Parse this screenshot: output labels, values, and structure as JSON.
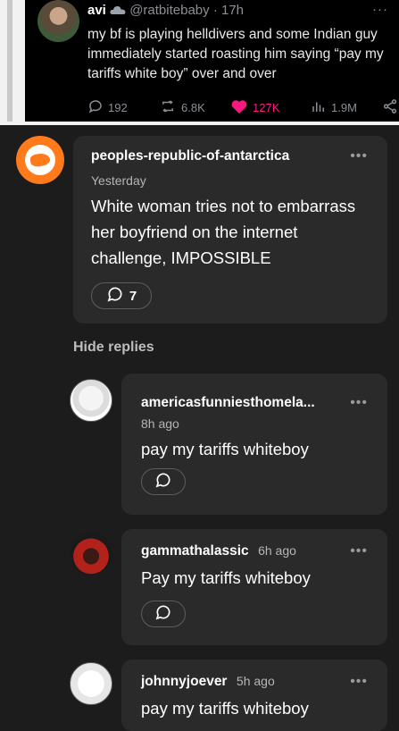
{
  "tweet": {
    "name": "avi",
    "handle": "@ratbitebaby",
    "time": "17h",
    "text": "my bf is playing helldivers and some Indian guy immediately started roasting him saying “pay my tariffs white boy” over and over",
    "replies": "192",
    "retweets": "6.8K",
    "likes": "127K",
    "views": "1.9M",
    "like_color": "#f91880"
  },
  "post": {
    "username": "peoples-republic-of-antarctica",
    "time": "Yesterday",
    "text": "White woman tries not to embarrass her boyfriend on the internet challenge, IMPOSSIBLE",
    "reply_count": "7",
    "accent": "#ff7a1a"
  },
  "hide_replies_label": "Hide replies",
  "replies": [
    {
      "username": "americasfunniesthomela...",
      "time": "8h ago",
      "text": "pay my tariffs whiteboy"
    },
    {
      "username": "gammathalassic",
      "time": "6h ago",
      "text": "Pay my tariffs whiteboy"
    },
    {
      "username": "johnnyjoever",
      "time": "5h ago",
      "text": "pay my tariffs whiteboy"
    }
  ]
}
